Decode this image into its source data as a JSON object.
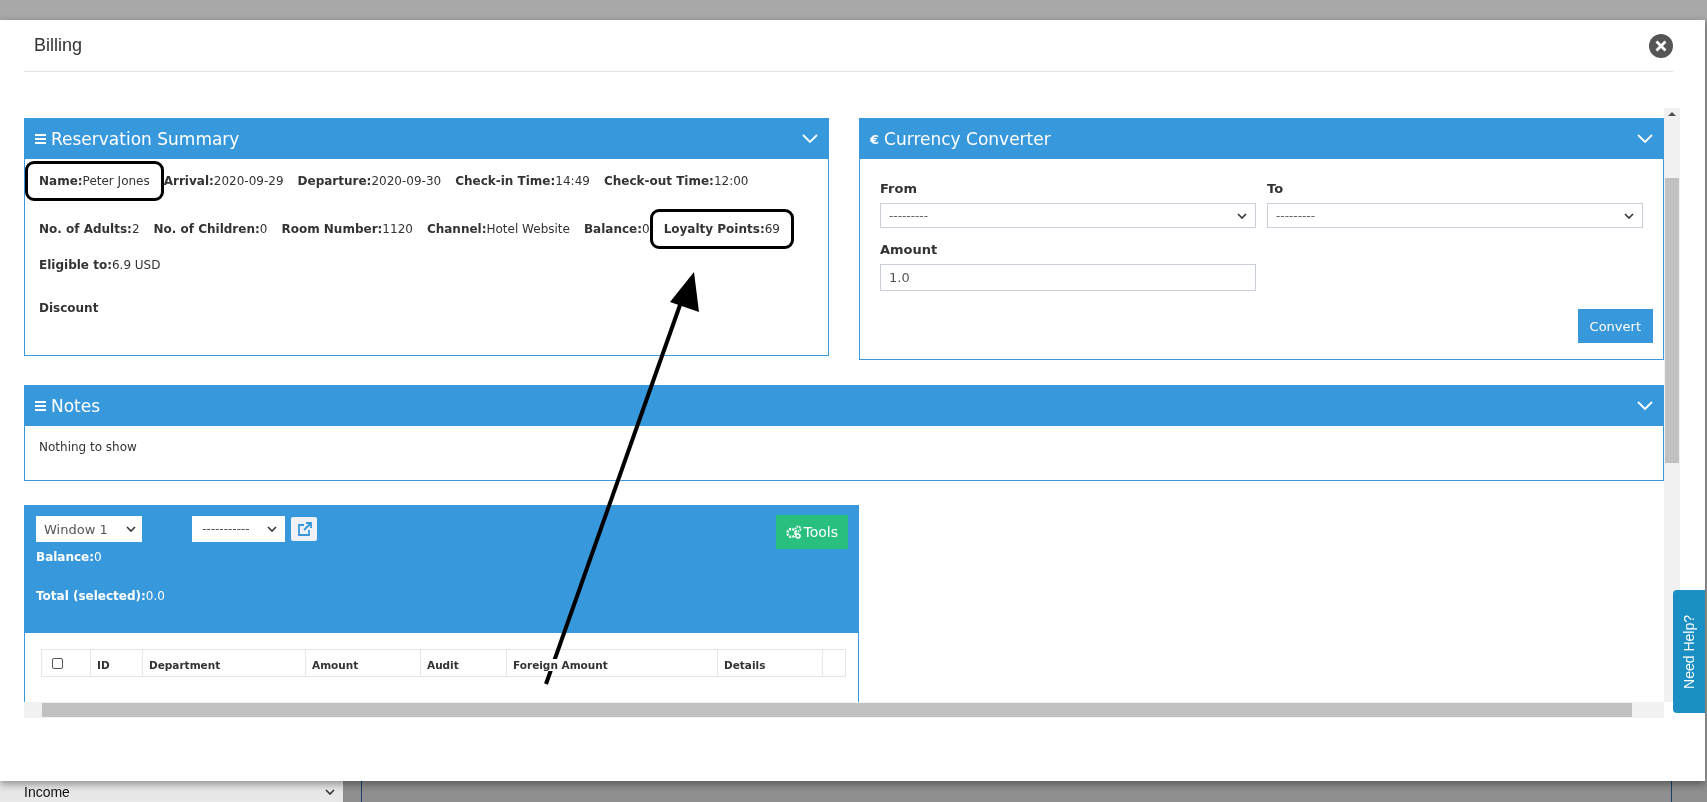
{
  "backdrop": {
    "select_value": "Income"
  },
  "modal": {
    "title": "Billing"
  },
  "reservation_summary": {
    "title": "Reservation Summary",
    "rows": [
      [
        {
          "label": "Name:",
          "value": "Peter Jones",
          "highlighted": true
        },
        {
          "label": "Arrival:",
          "value": "2020-09-29",
          "highlighted": false
        },
        {
          "label": "Departure:",
          "value": "2020-09-30",
          "highlighted": false
        },
        {
          "label": "Check-in Time:",
          "value": "14:49",
          "highlighted": false
        },
        {
          "label": "Check-out Time:",
          "value": "12:00",
          "highlighted": false
        }
      ],
      [
        {
          "label": "No. of Adults:",
          "value": "2",
          "highlighted": false
        },
        {
          "label": "No. of Children:",
          "value": "0",
          "highlighted": false
        },
        {
          "label": "Room Number:",
          "value": "1120",
          "highlighted": false
        },
        {
          "label": "Channel:",
          "value": "Hotel Website",
          "highlighted": false
        },
        {
          "label": "Balance:",
          "value": "0",
          "highlighted": false
        },
        {
          "label": "Loyalty Points:",
          "value": "69",
          "highlighted": true
        }
      ],
      [
        {
          "label": "Eligible to:",
          "value": "6.9 USD",
          "highlighted": false
        }
      ],
      [
        {
          "label": "Discount",
          "highlighted": false
        }
      ]
    ]
  },
  "currency_converter": {
    "icon": "€",
    "title": "Currency Converter",
    "from": {
      "label": "From",
      "value": "---------"
    },
    "to": {
      "label": "To",
      "value": "---------"
    },
    "amount": {
      "label": "Amount",
      "value": "1.0"
    },
    "button": "Convert"
  },
  "notes": {
    "title": "Notes",
    "message": "Nothing to show"
  },
  "folio": {
    "window_select": "Window 1",
    "filter_select": "-----------",
    "tools_button": "Tools",
    "balance": {
      "label": "Balance:",
      "value": "0"
    },
    "total": {
      "label": "Total (selected):",
      "value": "0.0"
    },
    "table": {
      "select_all_checked": false,
      "columns": [
        "ID",
        "Department",
        "Amount",
        "Audit",
        "Foreign Amount",
        "Details"
      ]
    }
  },
  "help_tab": "Need Help?"
}
